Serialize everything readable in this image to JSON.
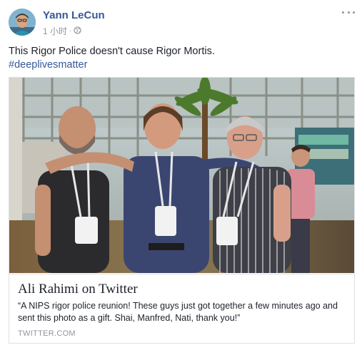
{
  "post": {
    "author": "Yann LeCun",
    "time": "1 小时",
    "privacy_icon": "globe-icon",
    "text_line1": "This Rigor Police doesn't cause Rigor Mortis.",
    "hashtag": "#deeplivesmatter"
  },
  "link_card": {
    "title": "Ali Rahimi on Twitter",
    "description": "“A NIPS rigor police reunion! These guys just got together a few minutes ago and sent this photo as a gift. Shai, Manfred, Nati, thank you!”",
    "domain": "TWITTER.COM"
  },
  "colors": {
    "link": "#365899",
    "meta": "#90949c",
    "text": "#1d2129",
    "border": "#dddfe2"
  }
}
